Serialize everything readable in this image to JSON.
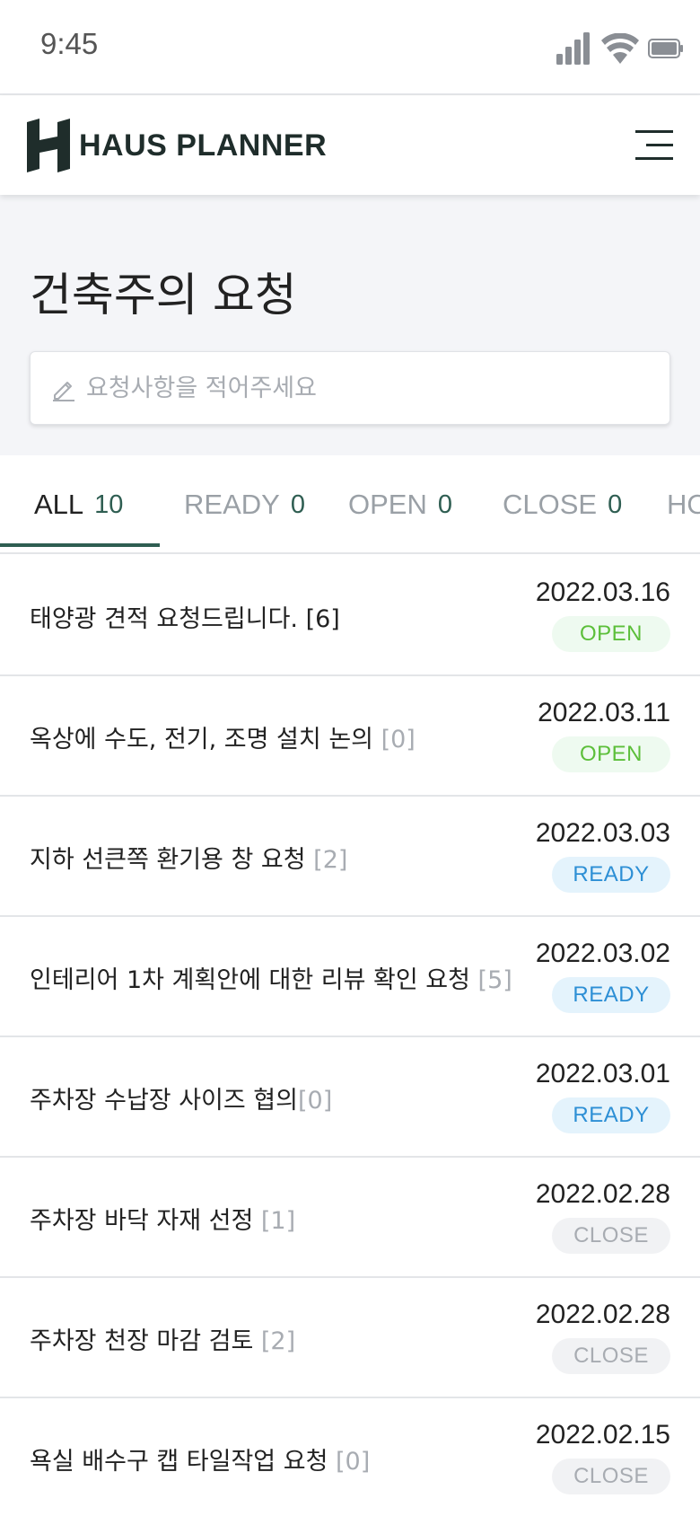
{
  "status_bar": {
    "time": "9:45"
  },
  "header": {
    "brand": "HAUS PLANNER"
  },
  "page": {
    "title": "건축주의 요청"
  },
  "search": {
    "placeholder": "요청사항을 적어주세요"
  },
  "tabs": [
    {
      "label": "ALL",
      "count": "10",
      "active": true
    },
    {
      "label": "READY",
      "count": "0"
    },
    {
      "label": "OPEN",
      "count": "0"
    },
    {
      "label": "CLOSE",
      "count": "0"
    },
    {
      "label": "HO",
      "count": ""
    }
  ],
  "colors": {
    "accent": "#2f5e52",
    "open": "#5cbf3a",
    "ready": "#2d8fd5",
    "close": "#a8acb2"
  },
  "requests": [
    {
      "title": "태양광 견적 요청드립니다. ",
      "count": "[6]",
      "date": "2022.03.16",
      "status": "OPEN",
      "status_key": "open"
    },
    {
      "title": "옥상에 수도, 전기, 조명 설치 논의 ",
      "count": "[0]",
      "date": "2022.03.11",
      "status": "OPEN",
      "status_key": "open"
    },
    {
      "title": "지하 선큰쪽 환기용 창 요청 ",
      "count": "[2]",
      "date": "2022.03.03",
      "status": "READY",
      "status_key": "ready"
    },
    {
      "title": "인테리어 1차 계획안에 대한 리뷰 확인 요청 ",
      "count": "[5]",
      "date": "2022.03.02",
      "status": "READY",
      "status_key": "ready"
    },
    {
      "title": "주차장 수납장 사이즈 협의",
      "count": "[0]",
      "date": "2022.03.01",
      "status": "READY",
      "status_key": "ready"
    },
    {
      "title": "주차장 바닥 자재 선정 ",
      "count": "[1]",
      "date": "2022.02.28",
      "status": "CLOSE",
      "status_key": "close"
    },
    {
      "title": "주차장 천장 마감 검토 ",
      "count": "[2]",
      "date": "2022.02.28",
      "status": "CLOSE",
      "status_key": "close"
    },
    {
      "title": "욕실 배수구 캡 타일작업 요청 ",
      "count": "[0]",
      "date": "2022.02.15",
      "status": "CLOSE",
      "status_key": "close"
    }
  ]
}
